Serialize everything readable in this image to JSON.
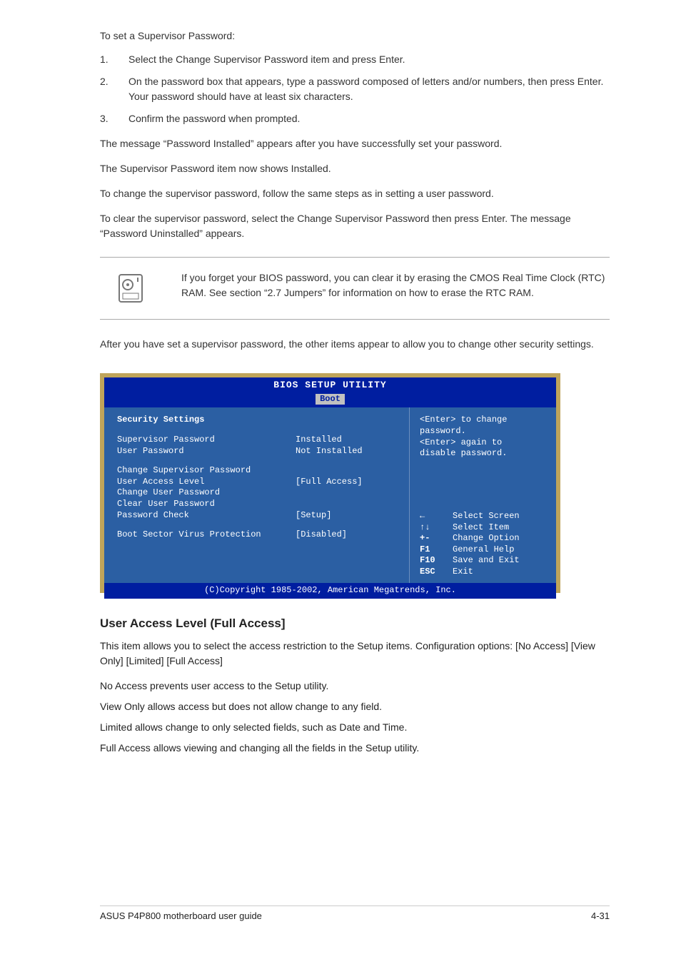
{
  "doc": {
    "p1": "To set a Supervisor Password:",
    "step1_num": "1.",
    "step1_text": "Select the Change Supervisor Password item and press Enter.",
    "step2_num": "2.",
    "step2_text_a": "On the password box that appears, type a password composed of letters and/or numbers, then press Enter. Your password should have at least six characters.",
    "step3_num": "3.",
    "step3_text": "Confirm the password when prompted.",
    "p_success": "The message “Password Installed” appears after you have successfully set your password.",
    "p_field": "The Supervisor Password item now shows Installed.",
    "p_change": "To change the supervisor password, follow the same steps as in setting a user password.",
    "p_clear": "To clear the supervisor password, select the Change Supervisor Password then press Enter. The message “Password Uninstalled” appears.",
    "note": "If you forget your BIOS password, you can clear it by erasing the CMOS Real Time Clock (RTC) RAM. See section “2.7 Jumpers” for information on how to erase the RTC RAM.",
    "p_after": "After you have set a supervisor password, the other items appear to allow you to change other security settings."
  },
  "bios": {
    "title": "BIOS SETUP UTILITY",
    "tab": "Boot",
    "section": "Security Settings",
    "rows": {
      "r1": {
        "label": "Supervisor Password",
        "value": "Installed"
      },
      "r2": {
        "label": "User Password",
        "value": "Not Installed"
      },
      "r3": {
        "label": "Change Supervisor Password",
        "value": ""
      },
      "r4": {
        "label": "User Access Level",
        "value": "[Full Access]"
      },
      "r5": {
        "label": "Change User Password",
        "value": ""
      },
      "r6": {
        "label": "Clear User Password",
        "value": ""
      },
      "r7": {
        "label": "Password Check",
        "value": "[Setup]"
      },
      "r8": {
        "label": "Boot Sector Virus Protection",
        "value": "[Disabled]"
      }
    },
    "help_top_1": "<Enter> to change",
    "help_top_2": "password.",
    "help_top_3": "<Enter> again to",
    "help_top_4": "disable password.",
    "help": {
      "h1": {
        "key": "←",
        "desc": "Select Screen"
      },
      "h2": {
        "key": "↑↓",
        "desc": "Select Item"
      },
      "h3": {
        "key": "+-",
        "desc": "Change Option"
      },
      "h4": {
        "key": "F1",
        "desc": "General Help"
      },
      "h5": {
        "key": "F10",
        "desc": "Save and Exit"
      },
      "h6": {
        "key": "ESC",
        "desc": "Exit"
      }
    },
    "footer": "(C)Copyright 1985-2002, American Megatrends, Inc."
  },
  "user_access": {
    "title": "User Access Level (Full Access]",
    "body": "This item allows you to select the access restriction to the Setup items. Configuration options: [No Access] [View Only] [Limited] [Full Access]",
    "no_access": "No Access prevents user access to the Setup utility.",
    "view_only": "View Only allows access but does not allow change to any field.",
    "limited": "Limited allows change to only selected fields, such as Date and Time.",
    "full": "Full Access allows viewing and changing all the fields in the Setup utility."
  },
  "footer": {
    "left": "ASUS P4P800 motherboard user guide",
    "right": "4-31"
  }
}
